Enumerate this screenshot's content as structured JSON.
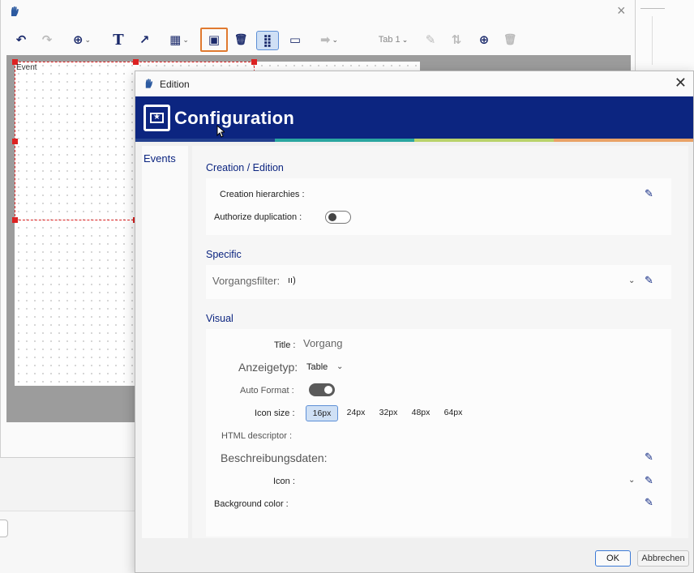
{
  "editor": {
    "close_glyph": "×",
    "toolbar": {
      "items": [
        {
          "icon": "undo-icon",
          "glyph": "↶"
        },
        {
          "icon": "redo-icon",
          "glyph": "↷"
        },
        {
          "icon": "add-icon",
          "glyph": "⊕"
        },
        {
          "icon": "text-icon",
          "glyph": "T"
        },
        {
          "icon": "export-icon",
          "glyph": "↗"
        },
        {
          "icon": "table-icon",
          "glyph": "▦"
        },
        {
          "icon": "configuration-icon",
          "glyph": "▣"
        },
        {
          "icon": "trash-icon",
          "glyph": "🗑"
        },
        {
          "icon": "grid-icon",
          "glyph": "⣿"
        },
        {
          "icon": "frame-icon",
          "glyph": "▭"
        },
        {
          "icon": "arrow-right-icon",
          "glyph": "➡"
        },
        {
          "icon": "pencil-icon",
          "glyph": "✎"
        },
        {
          "icon": "sort-icon",
          "glyph": "⇅"
        },
        {
          "icon": "add-circle-icon",
          "glyph": "⊕"
        },
        {
          "icon": "trash-disabled-icon",
          "glyph": "🗑"
        }
      ],
      "tab_label": "Tab 1"
    },
    "canvas": {
      "selection_label": "Event"
    }
  },
  "dialog": {
    "title": "Edition",
    "close_glyph": "✕",
    "banner_title": "Configuration",
    "banner_colors": {
      "background": "#0c2580",
      "stripe": [
        "#23408e",
        "#2aa6a0",
        "#b9d36a",
        "#e9a266"
      ]
    },
    "sidebar": {
      "items": [
        "Events"
      ]
    },
    "sections": {
      "creation": {
        "title": "Creation / Edition",
        "hierarchies_label": "Creation hierarchies :",
        "duplication_label": "Authorize duplication :",
        "duplication_on": false
      },
      "specific": {
        "title": "Specific",
        "filter_label": "Vorgangsfilter:",
        "filter_value": "ıı)"
      },
      "visual": {
        "title": "Visual",
        "title_label": "Title :",
        "title_value": "Vorgang",
        "display_type_label": "Anzeigetyp:",
        "display_type_value": "Table",
        "auto_format_label": "Auto Format :",
        "auto_format_on": true,
        "icon_size_label": "Icon size :",
        "icon_sizes": [
          "16px",
          "24px",
          "32px",
          "48px",
          "64px"
        ],
        "icon_size_selected": "16px",
        "html_descriptor_label": "HTML descriptor :",
        "description_data_label": "Beschreibungsdaten:",
        "icon_label": "Icon :",
        "background_color_label": "Background color :"
      }
    },
    "buttons": {
      "ok": "OK",
      "cancel": "Abbrechen"
    }
  }
}
